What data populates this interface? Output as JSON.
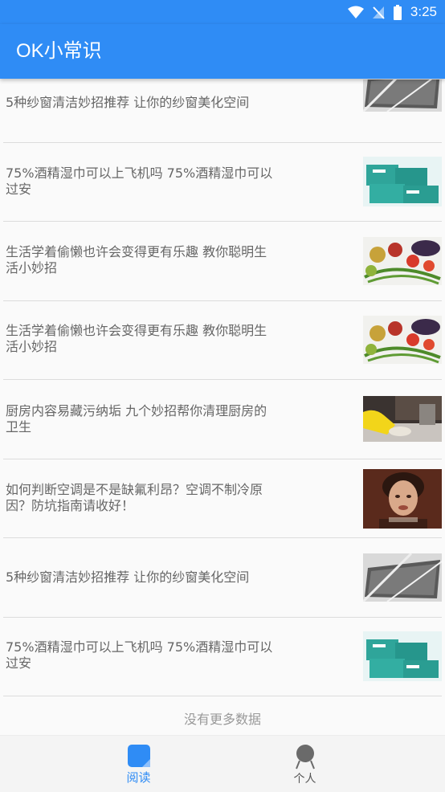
{
  "status_bar": {
    "time": "3:25"
  },
  "header": {
    "title": "OK小常识"
  },
  "articles": [
    {
      "title": "5种纱窗清洁妙招推荐 让你的纱窗美化空间",
      "thumb": "window-screen"
    },
    {
      "title": "75%酒精湿巾可以上飞机吗 75%酒精湿巾可以过安",
      "thumb": "wipes"
    },
    {
      "title": "生活学着偷懒也许会变得更有乐趣 教你聪明生活小妙招",
      "thumb": "vegetables"
    },
    {
      "title": "生活学着偷懒也许会变得更有乐趣 教你聪明生活小妙招",
      "thumb": "vegetables"
    },
    {
      "title": "厨房内容易藏污纳垢 九个妙招帮你清理厨房的卫生",
      "thumb": "kitchen-cleaning"
    },
    {
      "title": "如何判断空调是不是缺氟利昂？空调不制冷原因？防坑指南请收好！",
      "thumb": "woman-portrait"
    },
    {
      "title": "5种纱窗清洁妙招推荐 让你的纱窗美化空间",
      "thumb": "window-screen"
    },
    {
      "title": "75%酒精湿巾可以上飞机吗 75%酒精湿巾可以过安",
      "thumb": "wipes"
    }
  ],
  "list_footer": "没有更多数据",
  "tabs": [
    {
      "label": "阅读",
      "icon": "book-icon",
      "active": true
    },
    {
      "label": "个人",
      "icon": "person-icon",
      "active": false
    }
  ],
  "colors": {
    "primary": "#2f8cf5",
    "text": "#666666",
    "muted": "#999999",
    "tab_inactive": "#555555"
  }
}
